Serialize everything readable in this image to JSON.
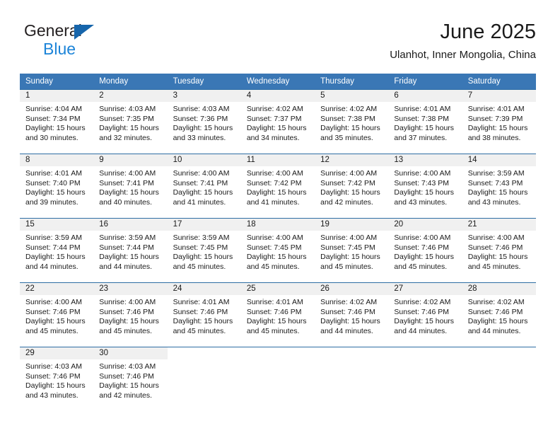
{
  "logo": {
    "word_top": "General",
    "word_bottom": "Blue",
    "triangle_icon": "triangle-icon",
    "color_dark": "#231f20",
    "color_blue": "#1c84d8",
    "color_triangle": "#1665ab"
  },
  "header": {
    "title": "June 2025",
    "subtitle": "Ulanhot, Inner Mongolia, China"
  },
  "theme": {
    "header_bg": "#3a77b5",
    "row_divider": "#2e6da4",
    "daynum_band_bg": "#f0f0f0",
    "text": "#1a1a1a"
  },
  "weekdays": [
    "Sunday",
    "Monday",
    "Tuesday",
    "Wednesday",
    "Thursday",
    "Friday",
    "Saturday"
  ],
  "weeks": [
    [
      {
        "day": "1",
        "sunrise": "Sunrise: 4:04 AM",
        "sunset": "Sunset: 7:34 PM",
        "daylight1": "Daylight: 15 hours",
        "daylight2": "and 30 minutes."
      },
      {
        "day": "2",
        "sunrise": "Sunrise: 4:03 AM",
        "sunset": "Sunset: 7:35 PM",
        "daylight1": "Daylight: 15 hours",
        "daylight2": "and 32 minutes."
      },
      {
        "day": "3",
        "sunrise": "Sunrise: 4:03 AM",
        "sunset": "Sunset: 7:36 PM",
        "daylight1": "Daylight: 15 hours",
        "daylight2": "and 33 minutes."
      },
      {
        "day": "4",
        "sunrise": "Sunrise: 4:02 AM",
        "sunset": "Sunset: 7:37 PM",
        "daylight1": "Daylight: 15 hours",
        "daylight2": "and 34 minutes."
      },
      {
        "day": "5",
        "sunrise": "Sunrise: 4:02 AM",
        "sunset": "Sunset: 7:38 PM",
        "daylight1": "Daylight: 15 hours",
        "daylight2": "and 35 minutes."
      },
      {
        "day": "6",
        "sunrise": "Sunrise: 4:01 AM",
        "sunset": "Sunset: 7:38 PM",
        "daylight1": "Daylight: 15 hours",
        "daylight2": "and 37 minutes."
      },
      {
        "day": "7",
        "sunrise": "Sunrise: 4:01 AM",
        "sunset": "Sunset: 7:39 PM",
        "daylight1": "Daylight: 15 hours",
        "daylight2": "and 38 minutes."
      }
    ],
    [
      {
        "day": "8",
        "sunrise": "Sunrise: 4:01 AM",
        "sunset": "Sunset: 7:40 PM",
        "daylight1": "Daylight: 15 hours",
        "daylight2": "and 39 minutes."
      },
      {
        "day": "9",
        "sunrise": "Sunrise: 4:00 AM",
        "sunset": "Sunset: 7:41 PM",
        "daylight1": "Daylight: 15 hours",
        "daylight2": "and 40 minutes."
      },
      {
        "day": "10",
        "sunrise": "Sunrise: 4:00 AM",
        "sunset": "Sunset: 7:41 PM",
        "daylight1": "Daylight: 15 hours",
        "daylight2": "and 41 minutes."
      },
      {
        "day": "11",
        "sunrise": "Sunrise: 4:00 AM",
        "sunset": "Sunset: 7:42 PM",
        "daylight1": "Daylight: 15 hours",
        "daylight2": "and 41 minutes."
      },
      {
        "day": "12",
        "sunrise": "Sunrise: 4:00 AM",
        "sunset": "Sunset: 7:42 PM",
        "daylight1": "Daylight: 15 hours",
        "daylight2": "and 42 minutes."
      },
      {
        "day": "13",
        "sunrise": "Sunrise: 4:00 AM",
        "sunset": "Sunset: 7:43 PM",
        "daylight1": "Daylight: 15 hours",
        "daylight2": "and 43 minutes."
      },
      {
        "day": "14",
        "sunrise": "Sunrise: 3:59 AM",
        "sunset": "Sunset: 7:43 PM",
        "daylight1": "Daylight: 15 hours",
        "daylight2": "and 43 minutes."
      }
    ],
    [
      {
        "day": "15",
        "sunrise": "Sunrise: 3:59 AM",
        "sunset": "Sunset: 7:44 PM",
        "daylight1": "Daylight: 15 hours",
        "daylight2": "and 44 minutes."
      },
      {
        "day": "16",
        "sunrise": "Sunrise: 3:59 AM",
        "sunset": "Sunset: 7:44 PM",
        "daylight1": "Daylight: 15 hours",
        "daylight2": "and 44 minutes."
      },
      {
        "day": "17",
        "sunrise": "Sunrise: 3:59 AM",
        "sunset": "Sunset: 7:45 PM",
        "daylight1": "Daylight: 15 hours",
        "daylight2": "and 45 minutes."
      },
      {
        "day": "18",
        "sunrise": "Sunrise: 4:00 AM",
        "sunset": "Sunset: 7:45 PM",
        "daylight1": "Daylight: 15 hours",
        "daylight2": "and 45 minutes."
      },
      {
        "day": "19",
        "sunrise": "Sunrise: 4:00 AM",
        "sunset": "Sunset: 7:45 PM",
        "daylight1": "Daylight: 15 hours",
        "daylight2": "and 45 minutes."
      },
      {
        "day": "20",
        "sunrise": "Sunrise: 4:00 AM",
        "sunset": "Sunset: 7:46 PM",
        "daylight1": "Daylight: 15 hours",
        "daylight2": "and 45 minutes."
      },
      {
        "day": "21",
        "sunrise": "Sunrise: 4:00 AM",
        "sunset": "Sunset: 7:46 PM",
        "daylight1": "Daylight: 15 hours",
        "daylight2": "and 45 minutes."
      }
    ],
    [
      {
        "day": "22",
        "sunrise": "Sunrise: 4:00 AM",
        "sunset": "Sunset: 7:46 PM",
        "daylight1": "Daylight: 15 hours",
        "daylight2": "and 45 minutes."
      },
      {
        "day": "23",
        "sunrise": "Sunrise: 4:00 AM",
        "sunset": "Sunset: 7:46 PM",
        "daylight1": "Daylight: 15 hours",
        "daylight2": "and 45 minutes."
      },
      {
        "day": "24",
        "sunrise": "Sunrise: 4:01 AM",
        "sunset": "Sunset: 7:46 PM",
        "daylight1": "Daylight: 15 hours",
        "daylight2": "and 45 minutes."
      },
      {
        "day": "25",
        "sunrise": "Sunrise: 4:01 AM",
        "sunset": "Sunset: 7:46 PM",
        "daylight1": "Daylight: 15 hours",
        "daylight2": "and 45 minutes."
      },
      {
        "day": "26",
        "sunrise": "Sunrise: 4:02 AM",
        "sunset": "Sunset: 7:46 PM",
        "daylight1": "Daylight: 15 hours",
        "daylight2": "and 44 minutes."
      },
      {
        "day": "27",
        "sunrise": "Sunrise: 4:02 AM",
        "sunset": "Sunset: 7:46 PM",
        "daylight1": "Daylight: 15 hours",
        "daylight2": "and 44 minutes."
      },
      {
        "day": "28",
        "sunrise": "Sunrise: 4:02 AM",
        "sunset": "Sunset: 7:46 PM",
        "daylight1": "Daylight: 15 hours",
        "daylight2": "and 44 minutes."
      }
    ],
    [
      {
        "day": "29",
        "sunrise": "Sunrise: 4:03 AM",
        "sunset": "Sunset: 7:46 PM",
        "daylight1": "Daylight: 15 hours",
        "daylight2": "and 43 minutes."
      },
      {
        "day": "30",
        "sunrise": "Sunrise: 4:03 AM",
        "sunset": "Sunset: 7:46 PM",
        "daylight1": "Daylight: 15 hours",
        "daylight2": "and 42 minutes."
      },
      {
        "day": "",
        "sunrise": "",
        "sunset": "",
        "daylight1": "",
        "daylight2": ""
      },
      {
        "day": "",
        "sunrise": "",
        "sunset": "",
        "daylight1": "",
        "daylight2": ""
      },
      {
        "day": "",
        "sunrise": "",
        "sunset": "",
        "daylight1": "",
        "daylight2": ""
      },
      {
        "day": "",
        "sunrise": "",
        "sunset": "",
        "daylight1": "",
        "daylight2": ""
      },
      {
        "day": "",
        "sunrise": "",
        "sunset": "",
        "daylight1": "",
        "daylight2": ""
      }
    ]
  ]
}
